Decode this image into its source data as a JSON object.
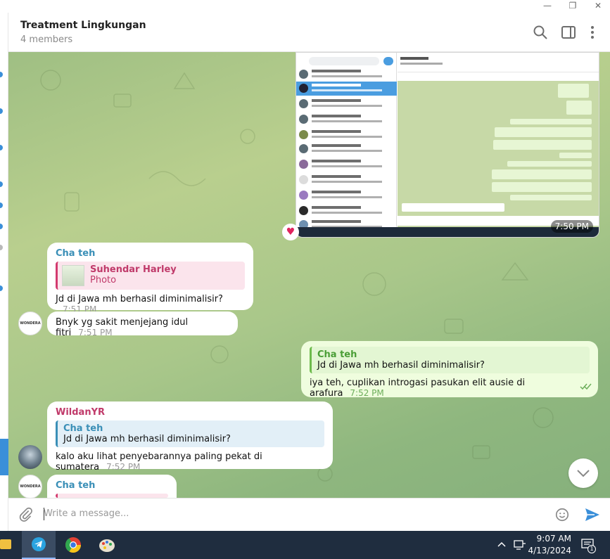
{
  "chat": {
    "title": "Treatment Lingkungan",
    "subtitle": "4 members"
  },
  "messages": [
    {
      "type": "image",
      "time": "7:50 PM"
    },
    {
      "sender": "Cha teh",
      "reply_name": "Suhendar Harley",
      "reply_text": "Photo",
      "text": "Jd di Jawa mh berhasil diminimalisir?",
      "time": "7:51 PM"
    },
    {
      "text": "Bnyk yg sakit menjejang idul fitri",
      "time": "7:51 PM"
    },
    {
      "reply_name": "Cha teh",
      "reply_text": "Jd di Jawa mh berhasil diminimalisir?",
      "text": "iya teh, cuplikan introgasi pasukan elit ausie di arafura",
      "time": "7:52 PM"
    },
    {
      "sender": "WildanYR",
      "reply_name": "Cha teh",
      "reply_text": "Jd di Jawa mh berhasil diminimalisir?",
      "text": "kalo aku lihat penyebarannya paling pekat di sumatera",
      "time": "7:52 PM"
    },
    {
      "sender": "Cha teh"
    }
  ],
  "compose": {
    "placeholder": "Write a message..."
  },
  "taskbar": {
    "time": "9:07 AM",
    "date": "4/13/2024",
    "notification_count": "1"
  },
  "colors": {
    "accent": "#3a8fd9",
    "outgoing_bubble": "#effdde",
    "sender_blue": "#3a8fb7",
    "sender_pink": "#c03a6a",
    "taskbar": "#1f2d3f"
  }
}
